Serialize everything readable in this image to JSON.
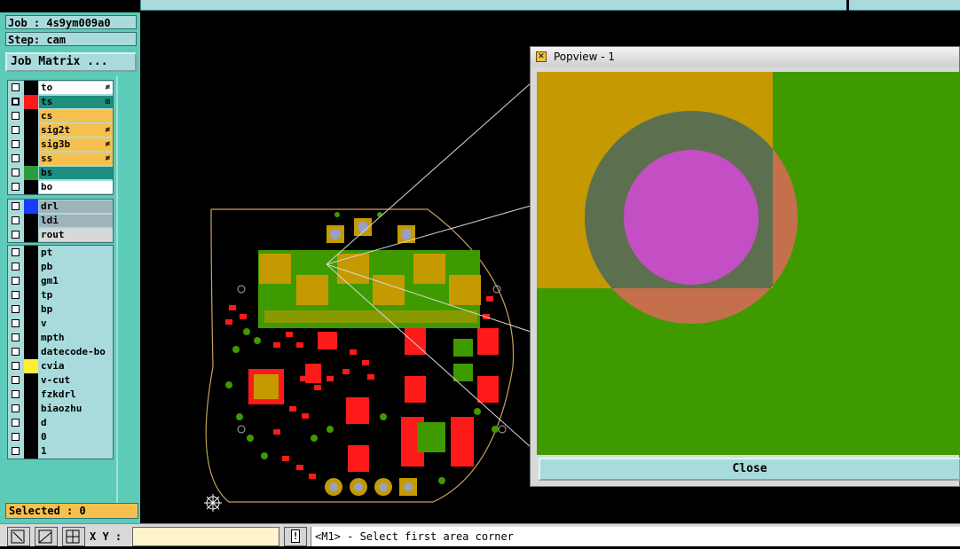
{
  "job": {
    "label": "Job : 4s9ym009a0"
  },
  "step": {
    "label": "Step: cam"
  },
  "job_matrix_button": "Job Matrix ...",
  "layer_groups": [
    [
      {
        "name": "to",
        "swatch": "#000000",
        "bg": "#ffffff",
        "icon": "≠",
        "selected": false
      },
      {
        "name": "ts",
        "swatch": "#ff1a1a",
        "bg": "#1e8f7e",
        "icon": "⊞",
        "selected": true
      },
      {
        "name": "cs",
        "swatch": "#000000",
        "bg": "#f6c04e",
        "icon": "",
        "selected": false
      },
      {
        "name": "sig2t",
        "swatch": "#000000",
        "bg": "#f6c04e",
        "icon": "≠",
        "selected": false
      },
      {
        "name": "sig3b",
        "swatch": "#000000",
        "bg": "#f6c04e",
        "icon": "≠",
        "selected": false
      },
      {
        "name": "ss",
        "swatch": "#000000",
        "bg": "#f6c04e",
        "icon": "≠",
        "selected": false
      },
      {
        "name": "bs",
        "swatch": "#2e9a3e",
        "bg": "#1e8f7e",
        "icon": "",
        "selected": false
      },
      {
        "name": "bo",
        "swatch": "#000000",
        "bg": "#ffffff",
        "icon": "",
        "selected": false
      }
    ],
    [
      {
        "name": "drl",
        "swatch": "#1a3cff",
        "bg": "#9fb3bb",
        "icon": "",
        "selected": false
      },
      {
        "name": "ldi",
        "swatch": "#000000",
        "bg": "#9fb3bb",
        "icon": "",
        "selected": false
      },
      {
        "name": "rout",
        "swatch": "#000000",
        "bg": "#d8d8d8",
        "icon": "",
        "selected": false
      }
    ],
    [
      {
        "name": "pt",
        "swatch": "#000000",
        "bg": "#a9dbdc",
        "icon": "",
        "selected": false
      },
      {
        "name": "pb",
        "swatch": "#000000",
        "bg": "#a9dbdc",
        "icon": "",
        "selected": false
      },
      {
        "name": "gm1",
        "swatch": "#000000",
        "bg": "#a9dbdc",
        "icon": "",
        "selected": false
      },
      {
        "name": "tp",
        "swatch": "#000000",
        "bg": "#a9dbdc",
        "icon": "",
        "selected": false
      },
      {
        "name": "bp",
        "swatch": "#000000",
        "bg": "#a9dbdc",
        "icon": "",
        "selected": false
      },
      {
        "name": "v",
        "swatch": "#000000",
        "bg": "#a9dbdc",
        "icon": "",
        "selected": false
      },
      {
        "name": "mpth",
        "swatch": "#000000",
        "bg": "#a9dbdc",
        "icon": "",
        "selected": false
      },
      {
        "name": "datecode-bo",
        "swatch": "#000000",
        "bg": "#a9dbdc",
        "icon": "",
        "selected": false
      },
      {
        "name": "cvia",
        "swatch": "#ffee33",
        "bg": "#a9dbdc",
        "icon": "",
        "selected": false
      },
      {
        "name": "v-cut",
        "swatch": "#000000",
        "bg": "#a9dbdc",
        "icon": "",
        "selected": false
      },
      {
        "name": "fzkdrl",
        "swatch": "#000000",
        "bg": "#a9dbdc",
        "icon": "",
        "selected": false
      },
      {
        "name": "biaozhu",
        "swatch": "#000000",
        "bg": "#a9dbdc",
        "icon": "",
        "selected": false
      },
      {
        "name": "d",
        "swatch": "#000000",
        "bg": "#a9dbdc",
        "icon": "",
        "selected": false
      },
      {
        "name": "0",
        "swatch": "#000000",
        "bg": "#a9dbdc",
        "icon": "",
        "selected": false
      },
      {
        "name": "1",
        "swatch": "#000000",
        "bg": "#a9dbdc",
        "icon": "",
        "selected": false
      }
    ]
  ],
  "selected_label": "Selected : 0",
  "popview": {
    "title": "Popview - 1",
    "close_label": "Close"
  },
  "status": {
    "xy_label": "X Y :",
    "xy_value": "",
    "message": "<M1> - Select first area corner"
  },
  "colors": {
    "panel": "#5ccbb7",
    "button": "#a9dbdc",
    "copper_green": "#3f9a00",
    "pad_gold": "#c49a00",
    "drill_magenta": "#c44ec4",
    "mask_red": "#ff1a1a"
  }
}
